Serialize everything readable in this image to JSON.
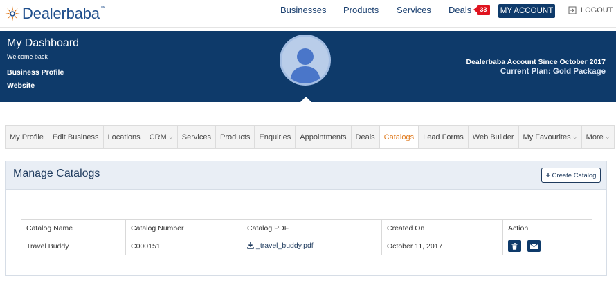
{
  "brand": {
    "name": "Dealerbaba",
    "tm": "™"
  },
  "nav": {
    "businesses": "Businesses",
    "products": "Products",
    "services": "Services",
    "deals": "Deals",
    "deals_count": "33",
    "my_account": "MY ACCOUNT",
    "logout": "LOGOUT"
  },
  "hero": {
    "title": "My Dashboard",
    "welcome": "Welcome back",
    "links": [
      "Business Profile",
      "Website"
    ],
    "account_since": "Dealerbaba Account Since October 2017",
    "current_plan": "Current Plan: Gold Package"
  },
  "tabs": [
    {
      "label": "My Profile"
    },
    {
      "label": "Edit Business"
    },
    {
      "label": "Locations"
    },
    {
      "label": "CRM"
    },
    {
      "label": "Services"
    },
    {
      "label": "Products"
    },
    {
      "label": "Enquiries"
    },
    {
      "label": "Appointments"
    },
    {
      "label": "Deals"
    },
    {
      "label": "Catalogs"
    },
    {
      "label": "Lead Forms"
    },
    {
      "label": "Web Builder"
    },
    {
      "label": "My Favourites"
    },
    {
      "label": "More"
    }
  ],
  "panel": {
    "title": "Manage Catalogs",
    "create_button": "Create Catalog",
    "table": {
      "headers": [
        "Catalog Name",
        "Catalog Number",
        "Catalog PDF",
        "Created On",
        "Action"
      ],
      "rows": [
        {
          "name": "Travel Buddy",
          "number": "C000151",
          "pdf": "_travel_buddy.pdf",
          "created": "October 11, 2017"
        }
      ]
    }
  },
  "colors": {
    "brand_navy": "#0e3a6a",
    "active_tab": "#e07b1f",
    "badge_red": "#e0141f"
  },
  "icons": [
    "sunburst-logo-icon",
    "logout-icon",
    "user-avatar-icon",
    "plus-icon",
    "download-icon",
    "trash-icon",
    "envelope-icon",
    "chevron-down-icon"
  ]
}
